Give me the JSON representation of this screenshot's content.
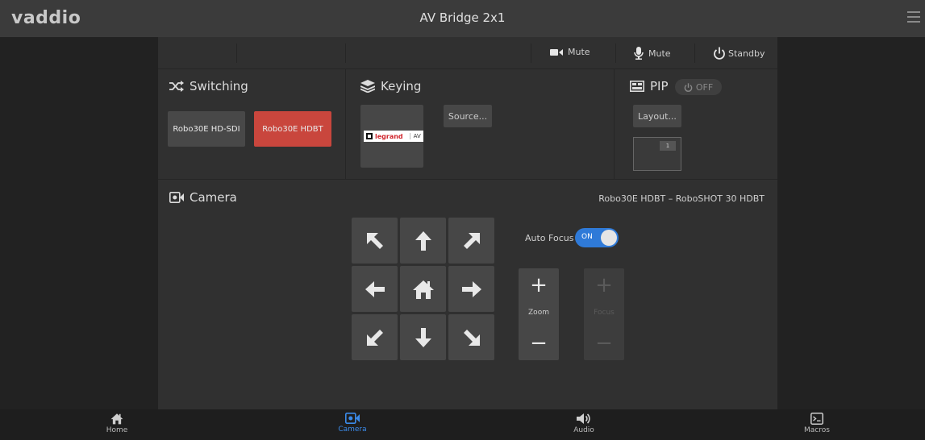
{
  "header": {
    "logo": "vaddio",
    "title": "AV Bridge 2x1"
  },
  "topbar": {
    "camera_mute": "Mute",
    "mic_mute": "Mute",
    "standby": "Standby"
  },
  "switching": {
    "title": "Switching",
    "sources": [
      {
        "label": "Robo30E HD-SDI",
        "active": false
      },
      {
        "label": "Robo30E HDBT",
        "active": true
      }
    ],
    "active_color": "#c9463d"
  },
  "keying": {
    "title": "Keying",
    "source_button": "Source...",
    "logo_brand": "legrand",
    "logo_suffix": "AV"
  },
  "pip": {
    "title": "PIP",
    "state": "OFF",
    "layout_button": "Layout...",
    "window_number": "1"
  },
  "camera": {
    "title": "Camera",
    "device": "Robo30E HDBT – RoboSHOT 30 HDBT",
    "autofocus_label": "Auto Focus",
    "autofocus_state": "ON",
    "zoom_label": "Zoom",
    "focus_label": "Focus"
  },
  "nav": {
    "items": [
      {
        "label": "Home",
        "icon": "home-icon"
      },
      {
        "label": "Camera",
        "icon": "camera-icon",
        "active": true
      },
      {
        "label": "Audio",
        "icon": "speaker-icon"
      },
      {
        "label": "Macros",
        "icon": "terminal-icon"
      }
    ],
    "active_color": "#3b8bea"
  }
}
